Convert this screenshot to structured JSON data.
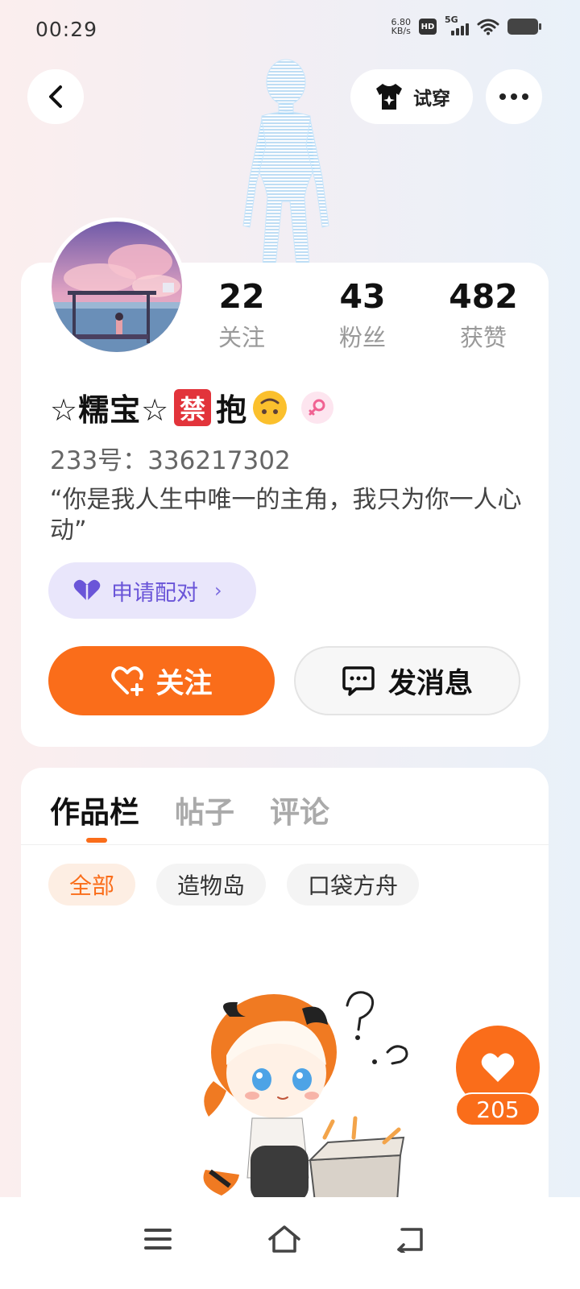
{
  "status_bar": {
    "time": "00:29",
    "net_speed_value": "6.80",
    "net_speed_unit": "KB/s",
    "hd": "HD",
    "network": "5G"
  },
  "header": {
    "try_on_label": "试穿"
  },
  "profile": {
    "stats": [
      {
        "value": "22",
        "label": "关注"
      },
      {
        "value": "43",
        "label": "粉丝"
      },
      {
        "value": "482",
        "label": "获赞"
      }
    ],
    "nickname": "☆糯宝☆",
    "ban_char": "禁",
    "hug_char": "抱",
    "uid": "233号：336217302",
    "bio": "“你是我人生中唯一的主角，我只为你一人心动”",
    "pair_label": "申请配对",
    "follow_label": "关注",
    "message_label": "发消息"
  },
  "content": {
    "tabs": [
      {
        "label": "作品栏"
      },
      {
        "label": "帖子"
      },
      {
        "label": "评论"
      }
    ],
    "filters": [
      {
        "label": "全部"
      },
      {
        "label": "造物岛"
      },
      {
        "label": "口袋方舟"
      }
    ],
    "like_count": "205"
  },
  "colors": {
    "accent": "#fa6d1a",
    "pair_bg": "#e9e6fb",
    "pair_text": "#6a55d8"
  }
}
